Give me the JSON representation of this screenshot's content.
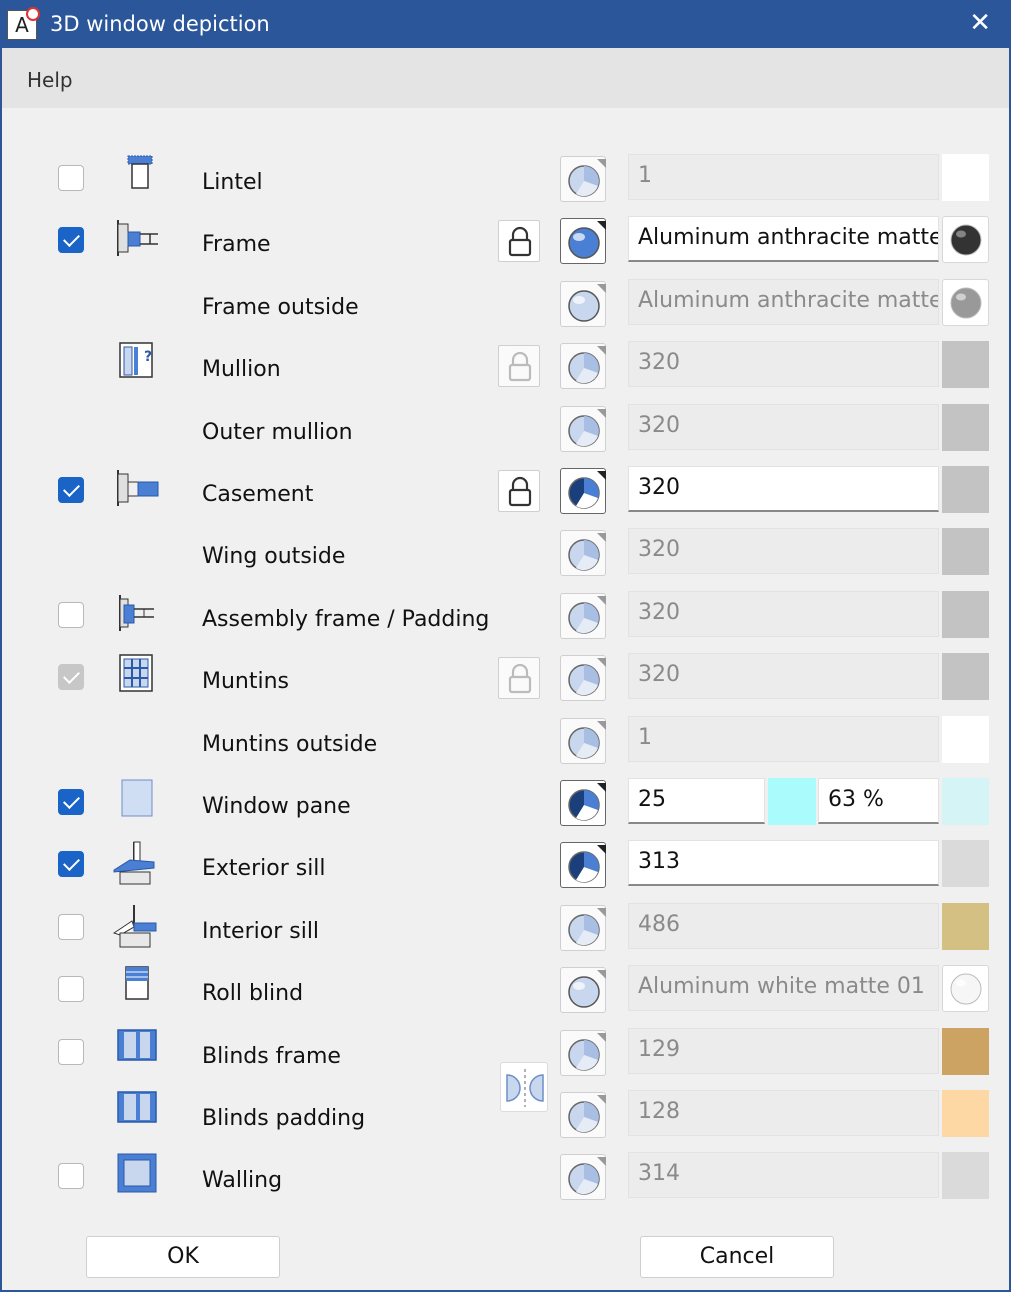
{
  "window": {
    "title": "3D window depiction",
    "app_icon_letter": "A",
    "close_glyph": "✕"
  },
  "menu": {
    "help": "Help"
  },
  "rows": [
    {
      "label": "Lintel",
      "checkbox": "unchecked",
      "icon": "lintel-icon",
      "lock": "none",
      "sphere": "inactive",
      "value": "1",
      "value_enabled": false,
      "swatch": "#ffffff"
    },
    {
      "label": "Frame",
      "checkbox": "checked",
      "icon": "frame-icon",
      "lock": "enabled",
      "sphere": "active-ball",
      "value": "Aluminum anthracite matte",
      "value_enabled": true,
      "swatch": "ball-dark"
    },
    {
      "label": "Frame outside",
      "checkbox": "none",
      "icon": "none",
      "lock": "none",
      "sphere": "inactive-ball",
      "value": "Aluminum anthracite matte",
      "value_enabled": false,
      "swatch": "ball-grey"
    },
    {
      "label": "Mullion",
      "checkbox": "none",
      "icon": "mullion-icon",
      "lock": "disabled",
      "sphere": "inactive",
      "value": "320",
      "value_enabled": false,
      "swatch": "#c3c3c3"
    },
    {
      "label": "Outer mullion",
      "checkbox": "none",
      "icon": "none",
      "lock": "none",
      "sphere": "inactive",
      "value": "320",
      "value_enabled": false,
      "swatch": "#c3c3c3"
    },
    {
      "label": "Casement",
      "checkbox": "checked",
      "icon": "casement-icon",
      "lock": "enabled",
      "sphere": "active",
      "value": "320",
      "value_enabled": true,
      "swatch": "#c3c3c3"
    },
    {
      "label": "Wing outside",
      "checkbox": "none",
      "icon": "none",
      "lock": "none",
      "sphere": "inactive",
      "value": "320",
      "value_enabled": false,
      "swatch": "#c3c3c3"
    },
    {
      "label": "Assembly frame / Padding",
      "checkbox": "unchecked",
      "icon": "assembly-frame-icon",
      "lock": "none",
      "sphere": "inactive",
      "value": "320",
      "value_enabled": false,
      "swatch": "#c3c3c3"
    },
    {
      "label": "Muntins",
      "checkbox": "checked-disabled",
      "icon": "muntins-icon",
      "lock": "disabled",
      "sphere": "inactive",
      "value": "320",
      "value_enabled": false,
      "swatch": "#c3c3c3"
    },
    {
      "label": "Muntins outside",
      "checkbox": "none",
      "icon": "none",
      "lock": "none",
      "sphere": "inactive",
      "value": "1",
      "value_enabled": false,
      "swatch": "#ffffff"
    },
    {
      "label": "Window pane",
      "checkbox": "checked",
      "icon": "window-pane-icon",
      "lock": "none",
      "sphere": "active",
      "value": "25",
      "value2": "63 %",
      "value_enabled": true,
      "split": true,
      "swatch_mid": "#aafcfc",
      "swatch": "#d4f4f6"
    },
    {
      "label": "Exterior sill",
      "checkbox": "checked",
      "icon": "exterior-sill-icon",
      "lock": "none",
      "sphere": "active",
      "value": "313",
      "value_enabled": true,
      "swatch": "#dadada"
    },
    {
      "label": "Interior sill",
      "checkbox": "unchecked",
      "icon": "interior-sill-icon",
      "lock": "none",
      "sphere": "inactive",
      "value": "486",
      "value_enabled": false,
      "swatch": "#d5c083"
    },
    {
      "label": "Roll blind",
      "checkbox": "unchecked",
      "icon": "roll-blind-icon",
      "lock": "none",
      "sphere": "inactive-ball",
      "value": "Aluminum white matte 01",
      "value_enabled": false,
      "swatch": "ball-white"
    },
    {
      "label": "Blinds frame",
      "checkbox": "unchecked",
      "icon": "blinds-frame-icon",
      "lock": "none",
      "sphere": "inactive",
      "value": "129",
      "value_enabled": false,
      "swatch": "#cca362"
    },
    {
      "label": "Blinds padding",
      "checkbox": "none",
      "icon": "blinds-padding-icon",
      "lock": "none",
      "sphere": "inactive",
      "value": "128",
      "value_enabled": false,
      "swatch": "#fdd8a4"
    },
    {
      "label": "Walling",
      "checkbox": "unchecked",
      "icon": "walling-icon",
      "lock": "none",
      "sphere": "inactive",
      "value": "314",
      "value_enabled": false,
      "swatch": "#dadada"
    }
  ],
  "buttons": {
    "ok": "OK",
    "cancel": "Cancel"
  },
  "colors": {
    "titlebar": "#2b579a",
    "accent": "#1a64c7",
    "icon_blue": "#4a7fd4"
  }
}
